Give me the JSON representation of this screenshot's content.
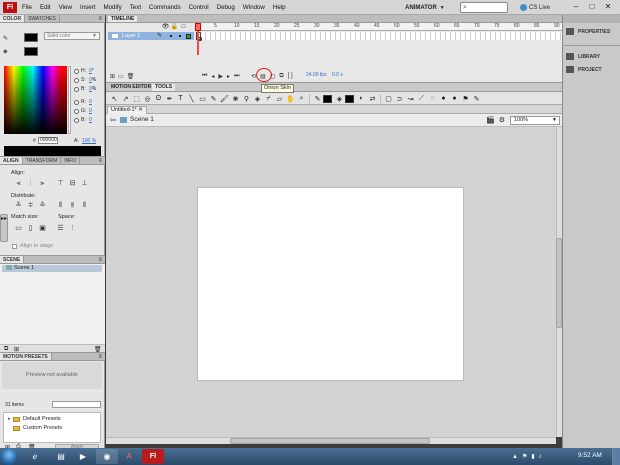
{
  "menubar": {
    "logo": "Fl",
    "items": [
      "File",
      "Edit",
      "View",
      "Insert",
      "Modify",
      "Text",
      "Commands",
      "Control",
      "Debug",
      "Window",
      "Help"
    ],
    "workspace": "ANIMATOR",
    "cs_live": "CS Live"
  },
  "color_panel": {
    "tabs": [
      "COLOR",
      "SWATCHES"
    ],
    "type": "Solid color",
    "h": {
      "label": "H:",
      "value": "0",
      "unit": "°"
    },
    "s": {
      "label": "S:",
      "value": "0",
      "unit": "%"
    },
    "b": {
      "label": "B:",
      "value": "0",
      "unit": "%"
    },
    "r": {
      "label": "R:",
      "value": "0"
    },
    "g": {
      "label": "G:",
      "value": "0"
    },
    "bl": {
      "label": "B:",
      "value": "0"
    },
    "hex_label": "#",
    "hex": "000000",
    "alpha_label": "A:",
    "alpha": "100 %",
    "stroke_color": "#000000",
    "fill_color": "#000000"
  },
  "align_panel": {
    "tabs": [
      "ALIGN",
      "TRANSFORM",
      "INFO"
    ],
    "align_label": "Align:",
    "distribute_label": "Distribute:",
    "match_size_label": "Match size:",
    "space_label": "Space:",
    "align_to_stage": "Align to stage"
  },
  "scene_panel": {
    "tab": "SCENE",
    "scene_name": "Scene 1"
  },
  "motion_presets": {
    "tab": "MOTION PRESETS",
    "preview": "Preview not available",
    "count": "31 items",
    "tree": [
      "Default Presets",
      "Custom Presets"
    ],
    "apply": "Apply"
  },
  "timeline": {
    "tab": "TIMELINE",
    "layer": "Layer 1",
    "frame_numbers": [
      "5",
      "10",
      "15",
      "20",
      "25",
      "30",
      "35",
      "40",
      "45",
      "50",
      "55",
      "60",
      "65",
      "70",
      "75",
      "80",
      "85",
      "90"
    ],
    "fps": "24.00 fps",
    "time": "0.0 s",
    "tooltip": "Onion Skin"
  },
  "editor_tabs": [
    "MOTION EDITOR",
    "TOOLS"
  ],
  "document": {
    "tab": "Untitled-1*",
    "scene": "Scene 1",
    "zoom": "100%"
  },
  "right_panels": [
    "PROPERTIES",
    "LIBRARY",
    "PROJECT"
  ],
  "taskbar": {
    "clock": "9:52 AM"
  }
}
